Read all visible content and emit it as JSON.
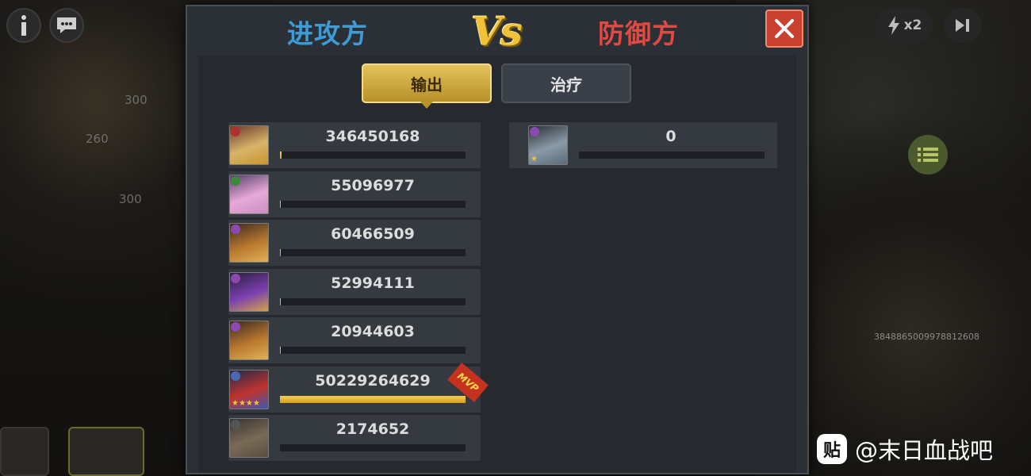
{
  "header": {
    "attacker_label": "进攻方",
    "vs_label": "Vs",
    "defender_label": "防御方"
  },
  "tabs": [
    {
      "label": "输出",
      "selected": true
    },
    {
      "label": "治疗",
      "selected": false
    }
  ],
  "attackers": [
    {
      "value": "346450168",
      "progress": 0.007,
      "mvp": false,
      "avatar": "hero-gold-helmet"
    },
    {
      "value": "55096977",
      "progress": 0.001,
      "mvp": false,
      "avatar": "hero-pink-hair"
    },
    {
      "value": "60466509",
      "progress": 0.001,
      "mvp": false,
      "avatar": "hero-gold-armor"
    },
    {
      "value": "52994111",
      "progress": 0.001,
      "mvp": false,
      "avatar": "hero-purple-mask"
    },
    {
      "value": "20944603",
      "progress": 0.0004,
      "mvp": false,
      "avatar": "hero-gold-armor"
    },
    {
      "value": "50229264629",
      "progress": 1.0,
      "mvp": true,
      "avatar": "hero-red-hat"
    },
    {
      "value": "2174652",
      "progress": 0.0,
      "mvp": false,
      "avatar": "vehicle-tank"
    }
  ],
  "mvp_label": "MVP",
  "defenders": [
    {
      "value": "0",
      "progress": 0.0,
      "avatar": "hero-armored-soldier"
    }
  ],
  "background": {
    "ghost_numbers": [
      "300",
      "260",
      "300"
    ],
    "right_number": "3848865009978812608",
    "speed_label": "x2"
  },
  "watermark": {
    "logo": "贴",
    "text": "@末日血战吧"
  },
  "colors": {
    "attacker": "#3f9bd6",
    "defender": "#e04a42",
    "accent_gold": "#e2c25b",
    "close_red": "#c9402e"
  }
}
